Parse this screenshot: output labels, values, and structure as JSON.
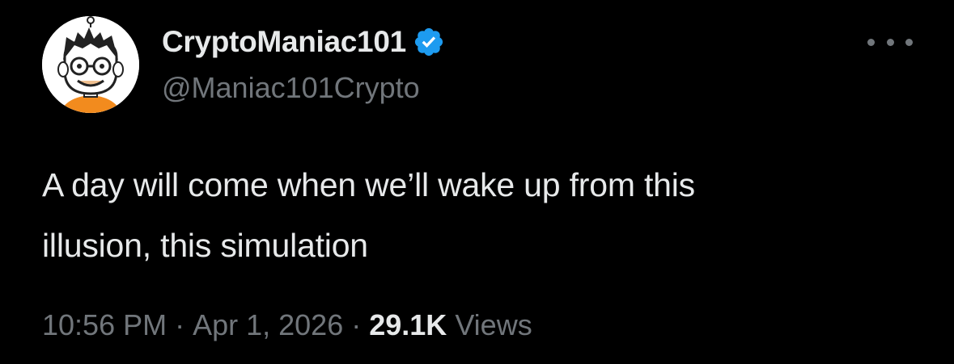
{
  "author": {
    "display_name": "CryptoManiac101",
    "handle": "@Maniac101Crypto",
    "verified": true,
    "verified_icon": "verified-badge-icon",
    "avatar_icon": "cartoon-face-avatar"
  },
  "more_icon": "more-horizontal-icon",
  "tweet": {
    "text_line_1": "A day will come when we’ll wake up from this",
    "text_line_2": "illusion, this simulation"
  },
  "meta": {
    "time": "10:56 PM",
    "separator": "·",
    "date": "Apr 1, 2026",
    "views_count": "29.1K",
    "views_label": "Views"
  },
  "colors": {
    "background": "#000000",
    "primary_text": "#e7e9ea",
    "secondary_text": "#71767b",
    "verified_blue": "#1d9bf0",
    "avatar_shirt": "#f28b1e"
  }
}
